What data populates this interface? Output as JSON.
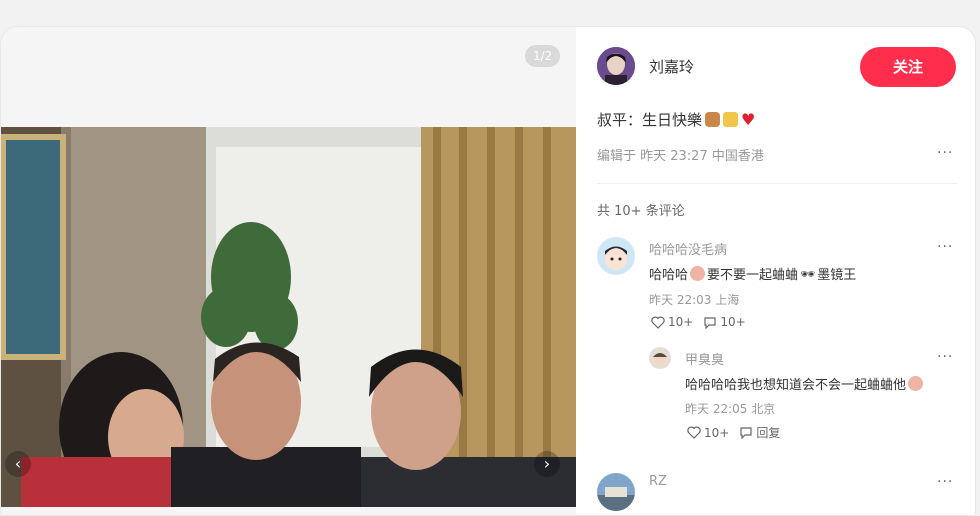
{
  "media": {
    "counter": "1/2",
    "prev_icon": "chevron-left-icon",
    "next_icon": "chevron-right-icon"
  },
  "author": {
    "name": "刘嘉玲",
    "follow_label": "关注"
  },
  "post": {
    "text": "叔平：生日快樂",
    "emojis": [
      "cake-icon",
      "cheers-icon",
      "heart-icon"
    ],
    "meta": "编辑于 昨天 23:27 中国香港"
  },
  "comments_header": "共 10+ 条评论",
  "comments": [
    {
      "user": "哈哈哈没毛病",
      "text": "哈哈哈",
      "text_after": "要不要一起蛐蛐",
      "text_tail": "墨镜王",
      "meta": "昨天 22:03 上海",
      "likes": "10+",
      "replies": "10+"
    },
    {
      "user": "甲臭臭",
      "text": "哈哈哈哈我也想知道会不会一起蛐蛐他",
      "meta": "昨天 22:05 北京",
      "likes": "10+",
      "reply_label": "回复"
    },
    {
      "user": "RZ"
    }
  ],
  "colors": {
    "accent": "#ff2e4d",
    "meta_gray": "#999999"
  }
}
